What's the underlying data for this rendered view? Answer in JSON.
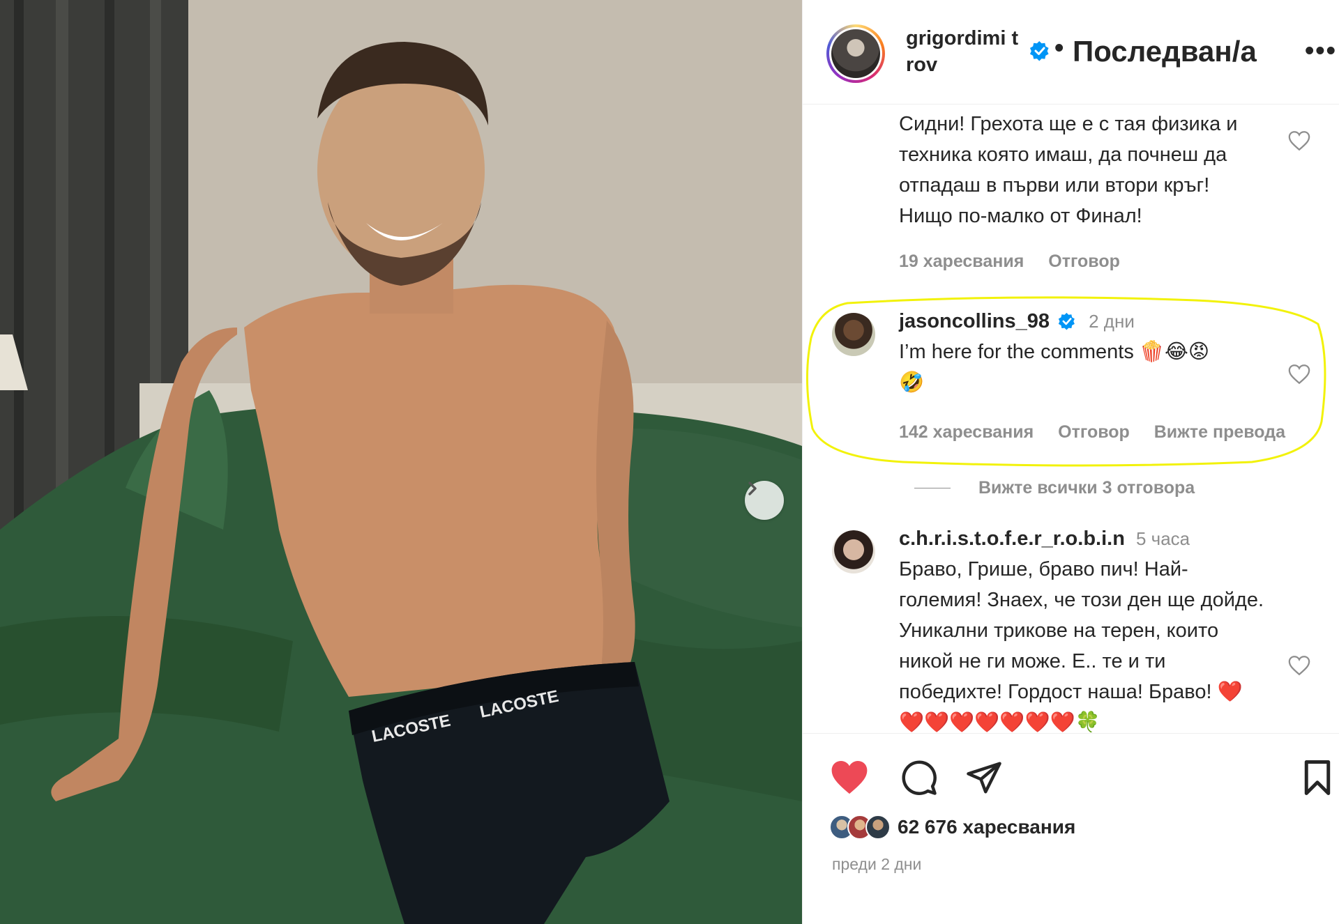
{
  "post": {
    "username": "grigordimitrov",
    "username_display": "grigordimi trov",
    "separator": "•",
    "follow_status": "Последван/а",
    "more": "•••",
    "likes_total": "62 676 харесвания",
    "time_ago": "преди 2 дни"
  },
  "photo": {
    "brand_text_1": "LACOSTE",
    "brand_text_2": "LACOSTE"
  },
  "comments": [
    {
      "text": "Сидни! Грехота ще е с тая физика и техника която имаш, да почнеш да отпадаш в първи или втори кръг! Нищо по-малко от Финал!",
      "likes": "19 харесвания",
      "reply": "Отговор"
    },
    {
      "username": "jasoncollins_98",
      "time": "2 дни",
      "text": "I’m here for the comments 🍿😂😡",
      "text_line2": "🤣",
      "likes": "142 харесвания",
      "reply": "Отговор",
      "translate": "Вижте превода",
      "view_replies": "Вижте всички 3 отговора"
    },
    {
      "username": "c.h.r.i.s.t.o.f.e.r_r.o.b.i.n",
      "time": "5 часа",
      "text": "Браво, Грише, браво пич! Най-големия! Знаех, че този ден ще дойде. Уникални трикове на терен, които никой не ги може. Е.. те и ти победихте! Гордост наша! Браво! ❤️❤️❤️❤️❤️❤️❤️❤️🍀"
    }
  ],
  "colors": {
    "like_red": "#ed4956",
    "verified_blue": "#0095f6",
    "highlight_yellow": "#f2f20a",
    "muted": "#8e8e8e"
  },
  "icons": {
    "like": "heart-filled-icon",
    "comment": "comment-bubble-icon",
    "share": "paper-plane-icon",
    "save": "bookmark-icon",
    "next": "chevron-right-icon"
  }
}
